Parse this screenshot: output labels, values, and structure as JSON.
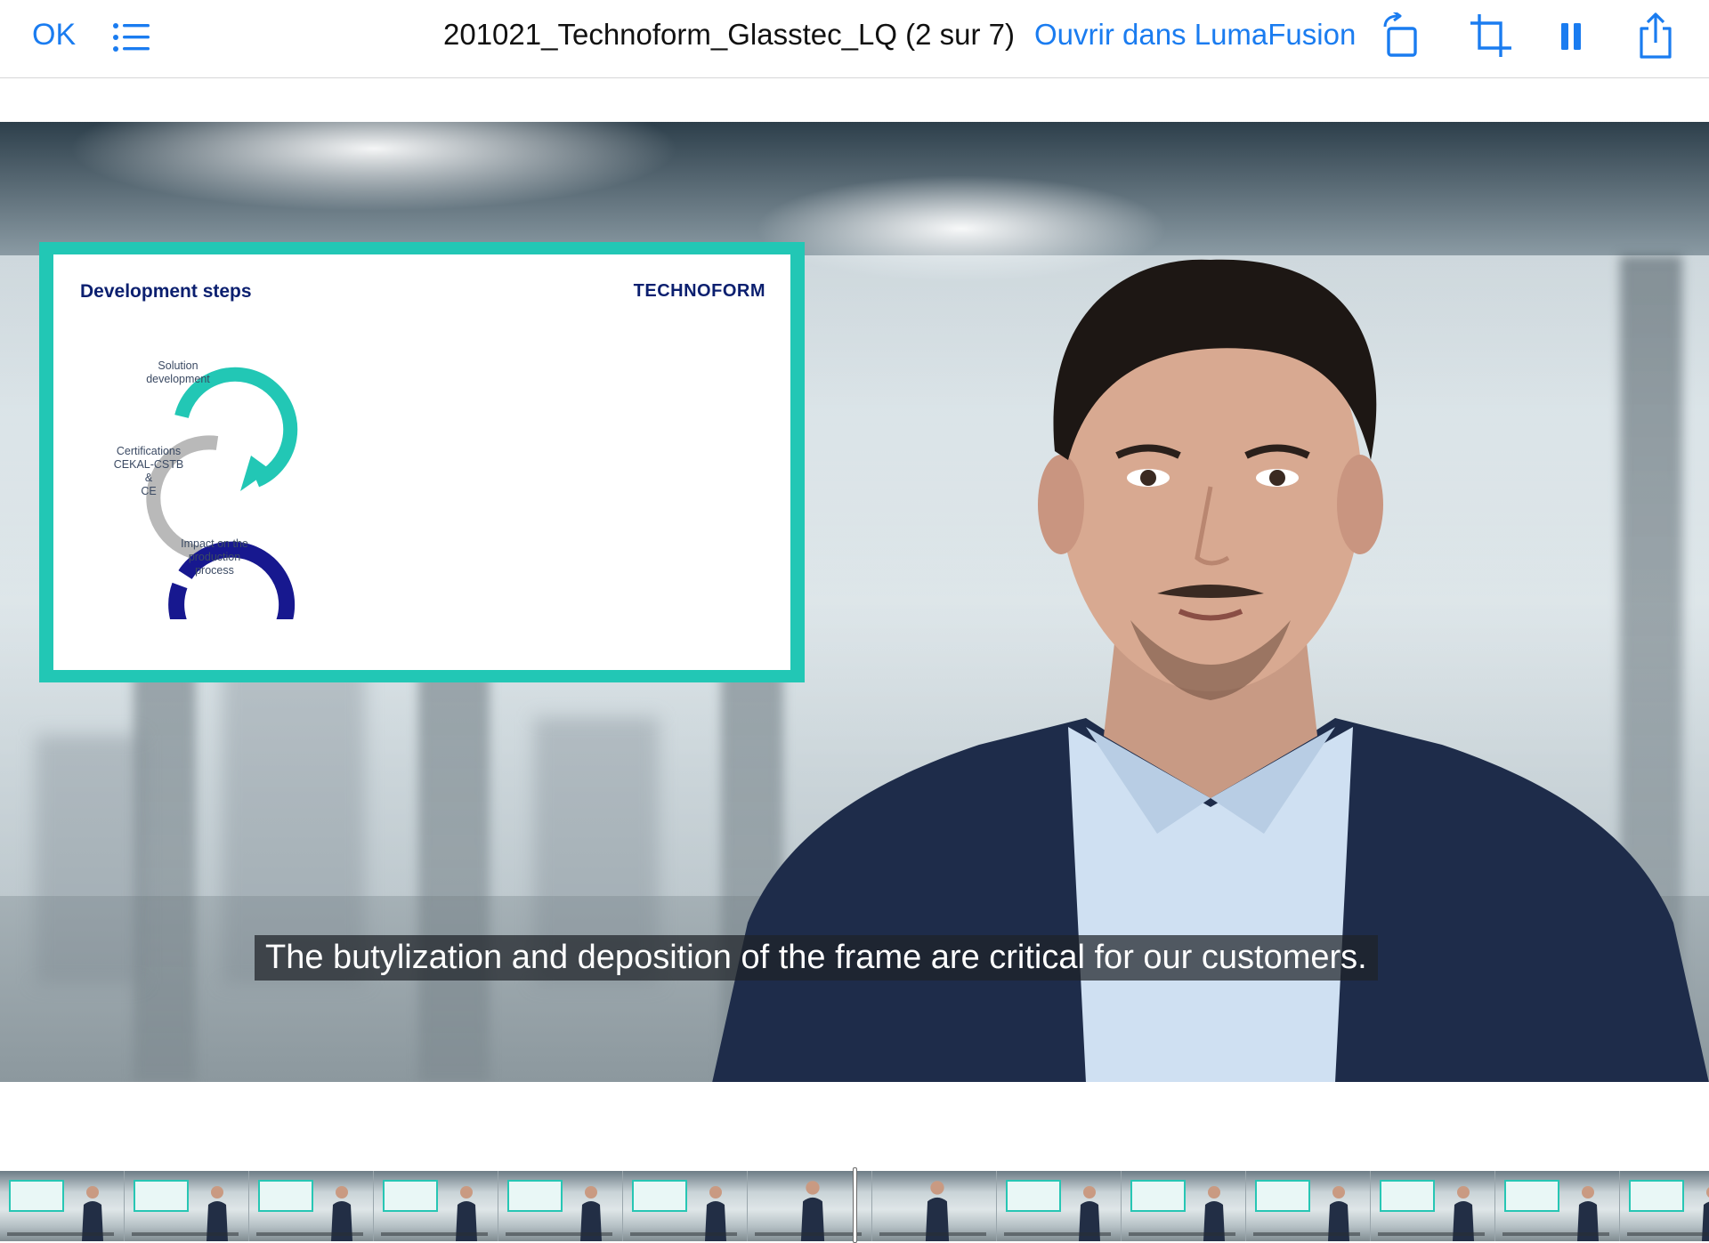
{
  "toolbar": {
    "done_label": "OK",
    "title": "201021_Technoform_Glasstec_LQ (2 sur 7)",
    "open_in_label": "Ouvrir dans LumaFusion",
    "icons": [
      "list-icon",
      "rotate-icon",
      "crop-icon",
      "pause-icon",
      "share-icon"
    ],
    "accent_color": "#1a7cf0"
  },
  "video": {
    "slide": {
      "title": "Development steps",
      "logo": "TECHNOFORM",
      "steps": [
        {
          "label_line1": "Solution",
          "label_line2": "development",
          "color": "#22c7b5"
        },
        {
          "label_line1": "Certifications",
          "label_line2": "CEKAL-CSTB &",
          "label_line3": "CE",
          "color": "#b9b9b9"
        },
        {
          "label_line1": "Impact on the",
          "label_line2": "production",
          "label_line3": "process",
          "color": "#17188f"
        }
      ],
      "border_color": "#22c7b5"
    },
    "subtitle": "The butylization and deposition of the frame are critical for our customers."
  },
  "filmstrip": {
    "frame_count": 14,
    "frames": [
      "slide",
      "slide",
      "slide",
      "slide",
      "slide",
      "slide",
      "close-up",
      "close-up",
      "slide",
      "slide",
      "slide",
      "slide",
      "slide",
      "slide"
    ]
  }
}
